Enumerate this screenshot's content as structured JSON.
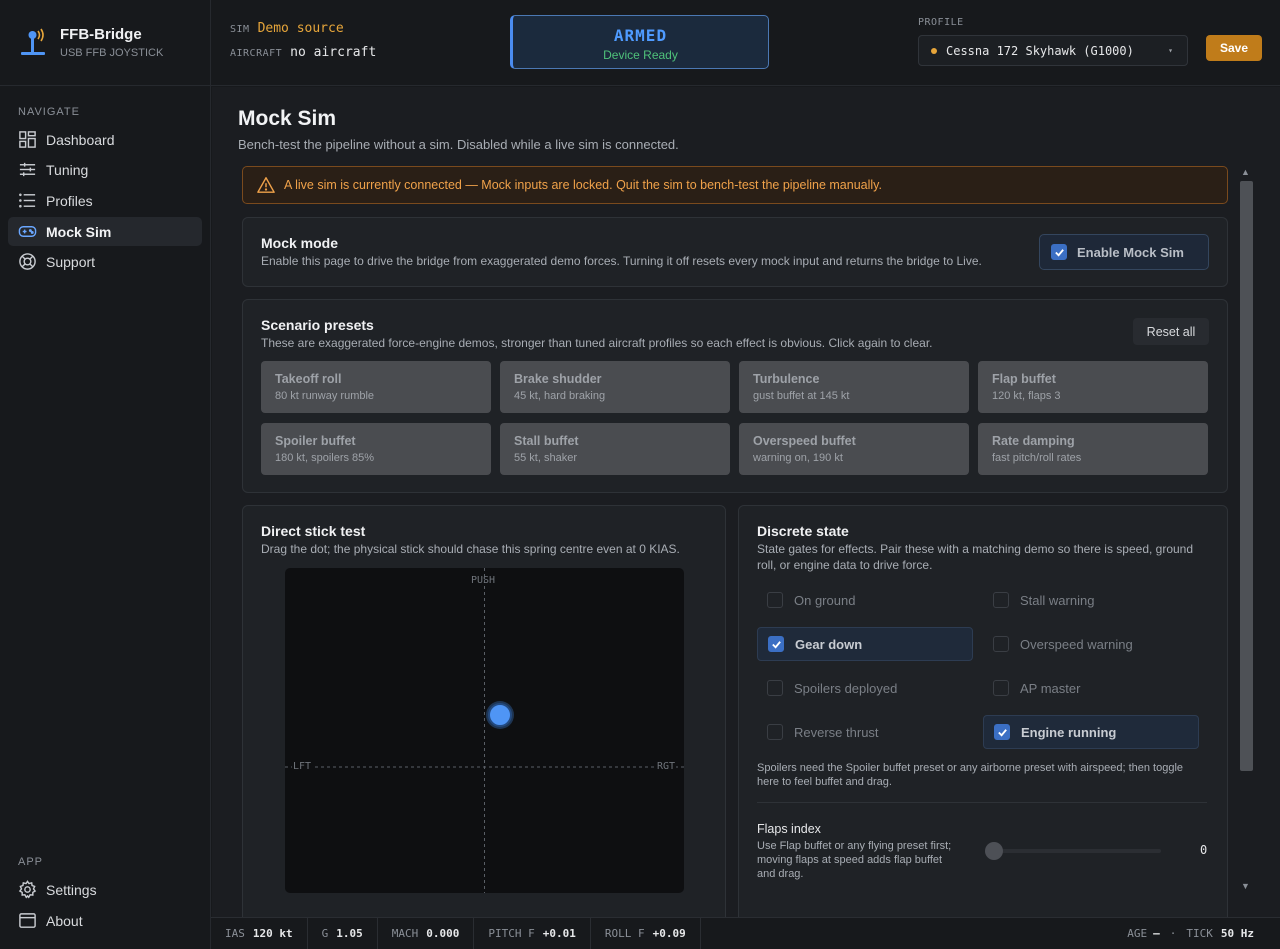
{
  "app": {
    "name": "FFB-Bridge",
    "subtitle": "USB FFB JOYSTICK"
  },
  "nav": {
    "heading": "NAVIGATE",
    "items": [
      {
        "label": "Dashboard",
        "icon": "dashboard-icon"
      },
      {
        "label": "Tuning",
        "icon": "sliders-icon"
      },
      {
        "label": "Profiles",
        "icon": "list-icon"
      },
      {
        "label": "Mock Sim",
        "icon": "gamepad-icon",
        "active": true
      },
      {
        "label": "Support",
        "icon": "lifebuoy-icon"
      }
    ],
    "app_heading": "APP",
    "app_items": [
      {
        "label": "Settings",
        "icon": "gear-icon"
      },
      {
        "label": "About",
        "icon": "window-icon"
      }
    ]
  },
  "header": {
    "sim_label": "SIM",
    "sim_value": "Demo source",
    "aircraft_label": "AIRCRAFT",
    "aircraft_value": "no aircraft",
    "status_title": "ARMED",
    "status_sub": "Device Ready",
    "profile_label": "PROFILE",
    "profile_value": "Cessna 172 Skyhawk (G1000)",
    "save_label": "Save"
  },
  "page": {
    "title": "Mock Sim",
    "subtitle": "Bench-test the pipeline without a sim. Disabled while a live sim is connected.",
    "warning": "A live sim is currently connected — Mock inputs are locked. Quit the sim to bench-test the pipeline manually."
  },
  "mock_mode": {
    "title": "Mock mode",
    "desc": "Enable this page to drive the bridge from exaggerated demo forces. Turning it off resets every mock input and returns the bridge to Live.",
    "toggle_label": "Enable Mock Sim",
    "enabled": true
  },
  "presets": {
    "title": "Scenario presets",
    "desc": "These are exaggerated force-engine demos, stronger than tuned aircraft profiles so each effect is obvious. Click again to clear.",
    "reset_label": "Reset all",
    "items": [
      {
        "name": "Takeoff roll",
        "desc": "80 kt runway rumble"
      },
      {
        "name": "Brake shudder",
        "desc": "45 kt, hard braking"
      },
      {
        "name": "Turbulence",
        "desc": "gust buffet at 145 kt"
      },
      {
        "name": "Flap buffet",
        "desc": "120 kt, flaps 3"
      },
      {
        "name": "Spoiler buffet",
        "desc": "180 kt, spoilers 85%"
      },
      {
        "name": "Stall buffet",
        "desc": "55 kt, shaker"
      },
      {
        "name": "Overspeed buffet",
        "desc": "warning on, 190 kt"
      },
      {
        "name": "Rate damping",
        "desc": "fast pitch/roll rates"
      }
    ]
  },
  "stick": {
    "title": "Direct stick test",
    "desc": "Drag the dot; the physical stick should chase this spring centre even at 0 KIAS.",
    "push_label": "PUSH",
    "left_label": "LFT",
    "right_label": "RGT",
    "roll": 0.08,
    "pitch": 0.26
  },
  "discrete": {
    "title": "Discrete state",
    "desc": "State gates for effects. Pair these with a matching demo so there is speed, ground roll, or engine data to drive force.",
    "items": [
      {
        "label": "On ground",
        "checked": false
      },
      {
        "label": "Stall warning",
        "checked": false
      },
      {
        "label": "Gear down",
        "checked": true
      },
      {
        "label": "Overspeed warning",
        "checked": false
      },
      {
        "label": "Spoilers deployed",
        "checked": false
      },
      {
        "label": "AP master",
        "checked": false
      },
      {
        "label": "Reverse thrust",
        "checked": false
      },
      {
        "label": "Engine running",
        "checked": true
      }
    ],
    "note": "Spoilers need the Spoiler buffet preset or any airborne preset with airspeed; then toggle here to feel buffet and drag.",
    "flaps_title": "Flaps index",
    "flaps_desc": "Use Flap buffet or any flying preset first; moving flaps at speed adds flap buffet and drag.",
    "flaps_value": "0"
  },
  "footer": {
    "ias_label": "IAS",
    "ias_value": "120 kt",
    "g_label": "G",
    "g_value": "1.05",
    "mach_label": "MACH",
    "mach_value": "0.000",
    "pitch_label": "PITCH F",
    "pitch_value": "+0.01",
    "roll_label": "ROLL F",
    "roll_value": "+0.09",
    "age_label": "AGE",
    "age_value": "—",
    "tick_label": "TICK",
    "tick_value": "50 Hz"
  }
}
